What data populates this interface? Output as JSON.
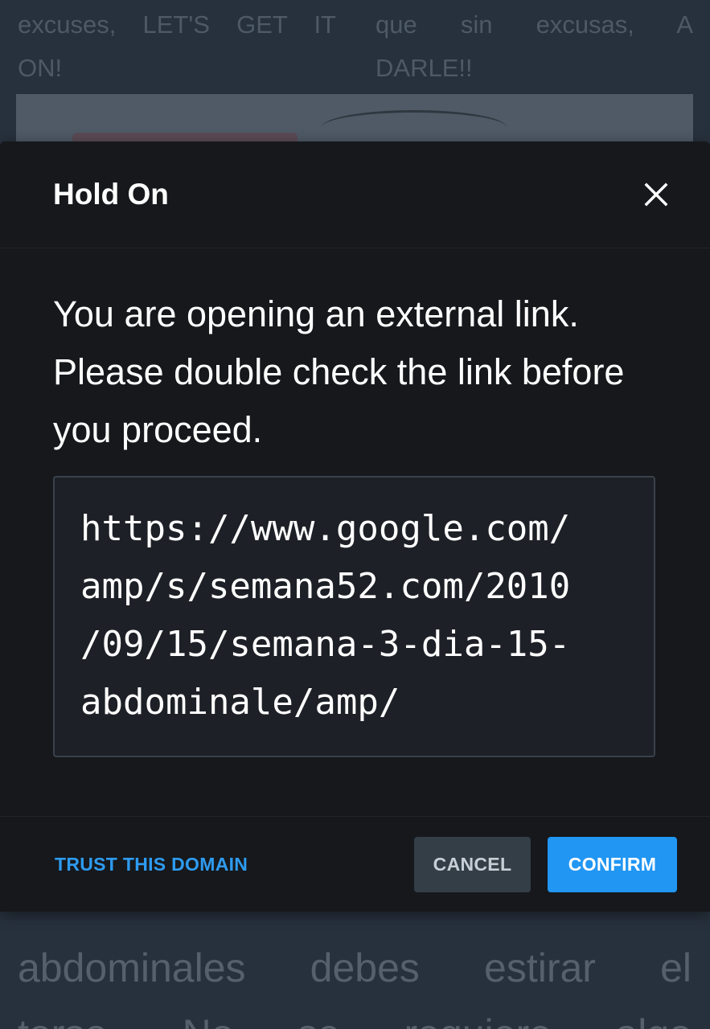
{
  "background": {
    "left_column_text": [
      "excuses, LET'S GET IT",
      "ON!"
    ],
    "right_column_text": [
      "que sin excusas, A",
      "DARLE!!"
    ],
    "bottom_text": [
      "abdominales debes estirar el",
      "torso. No se requiere algo"
    ]
  },
  "dialog": {
    "title": "Hold On",
    "close_icon": "close-icon",
    "message": "You are opening an external link. Please double check the link before you proceed.",
    "link_lines": [
      "https://www.google.com/",
      "amp/s/semana52.com/2010",
      "/09/15/semana-3-dia-15-",
      "abdominale/amp/"
    ],
    "trust_label": "TRUST THIS DOMAIN",
    "cancel_label": "CANCEL",
    "confirm_label": "CONFIRM"
  },
  "colors": {
    "accent": "#2196f3",
    "link": "#2e9bf0",
    "dialog_background": "#16181c",
    "page_background": "#27313d",
    "cancel_button": "#343e47"
  }
}
